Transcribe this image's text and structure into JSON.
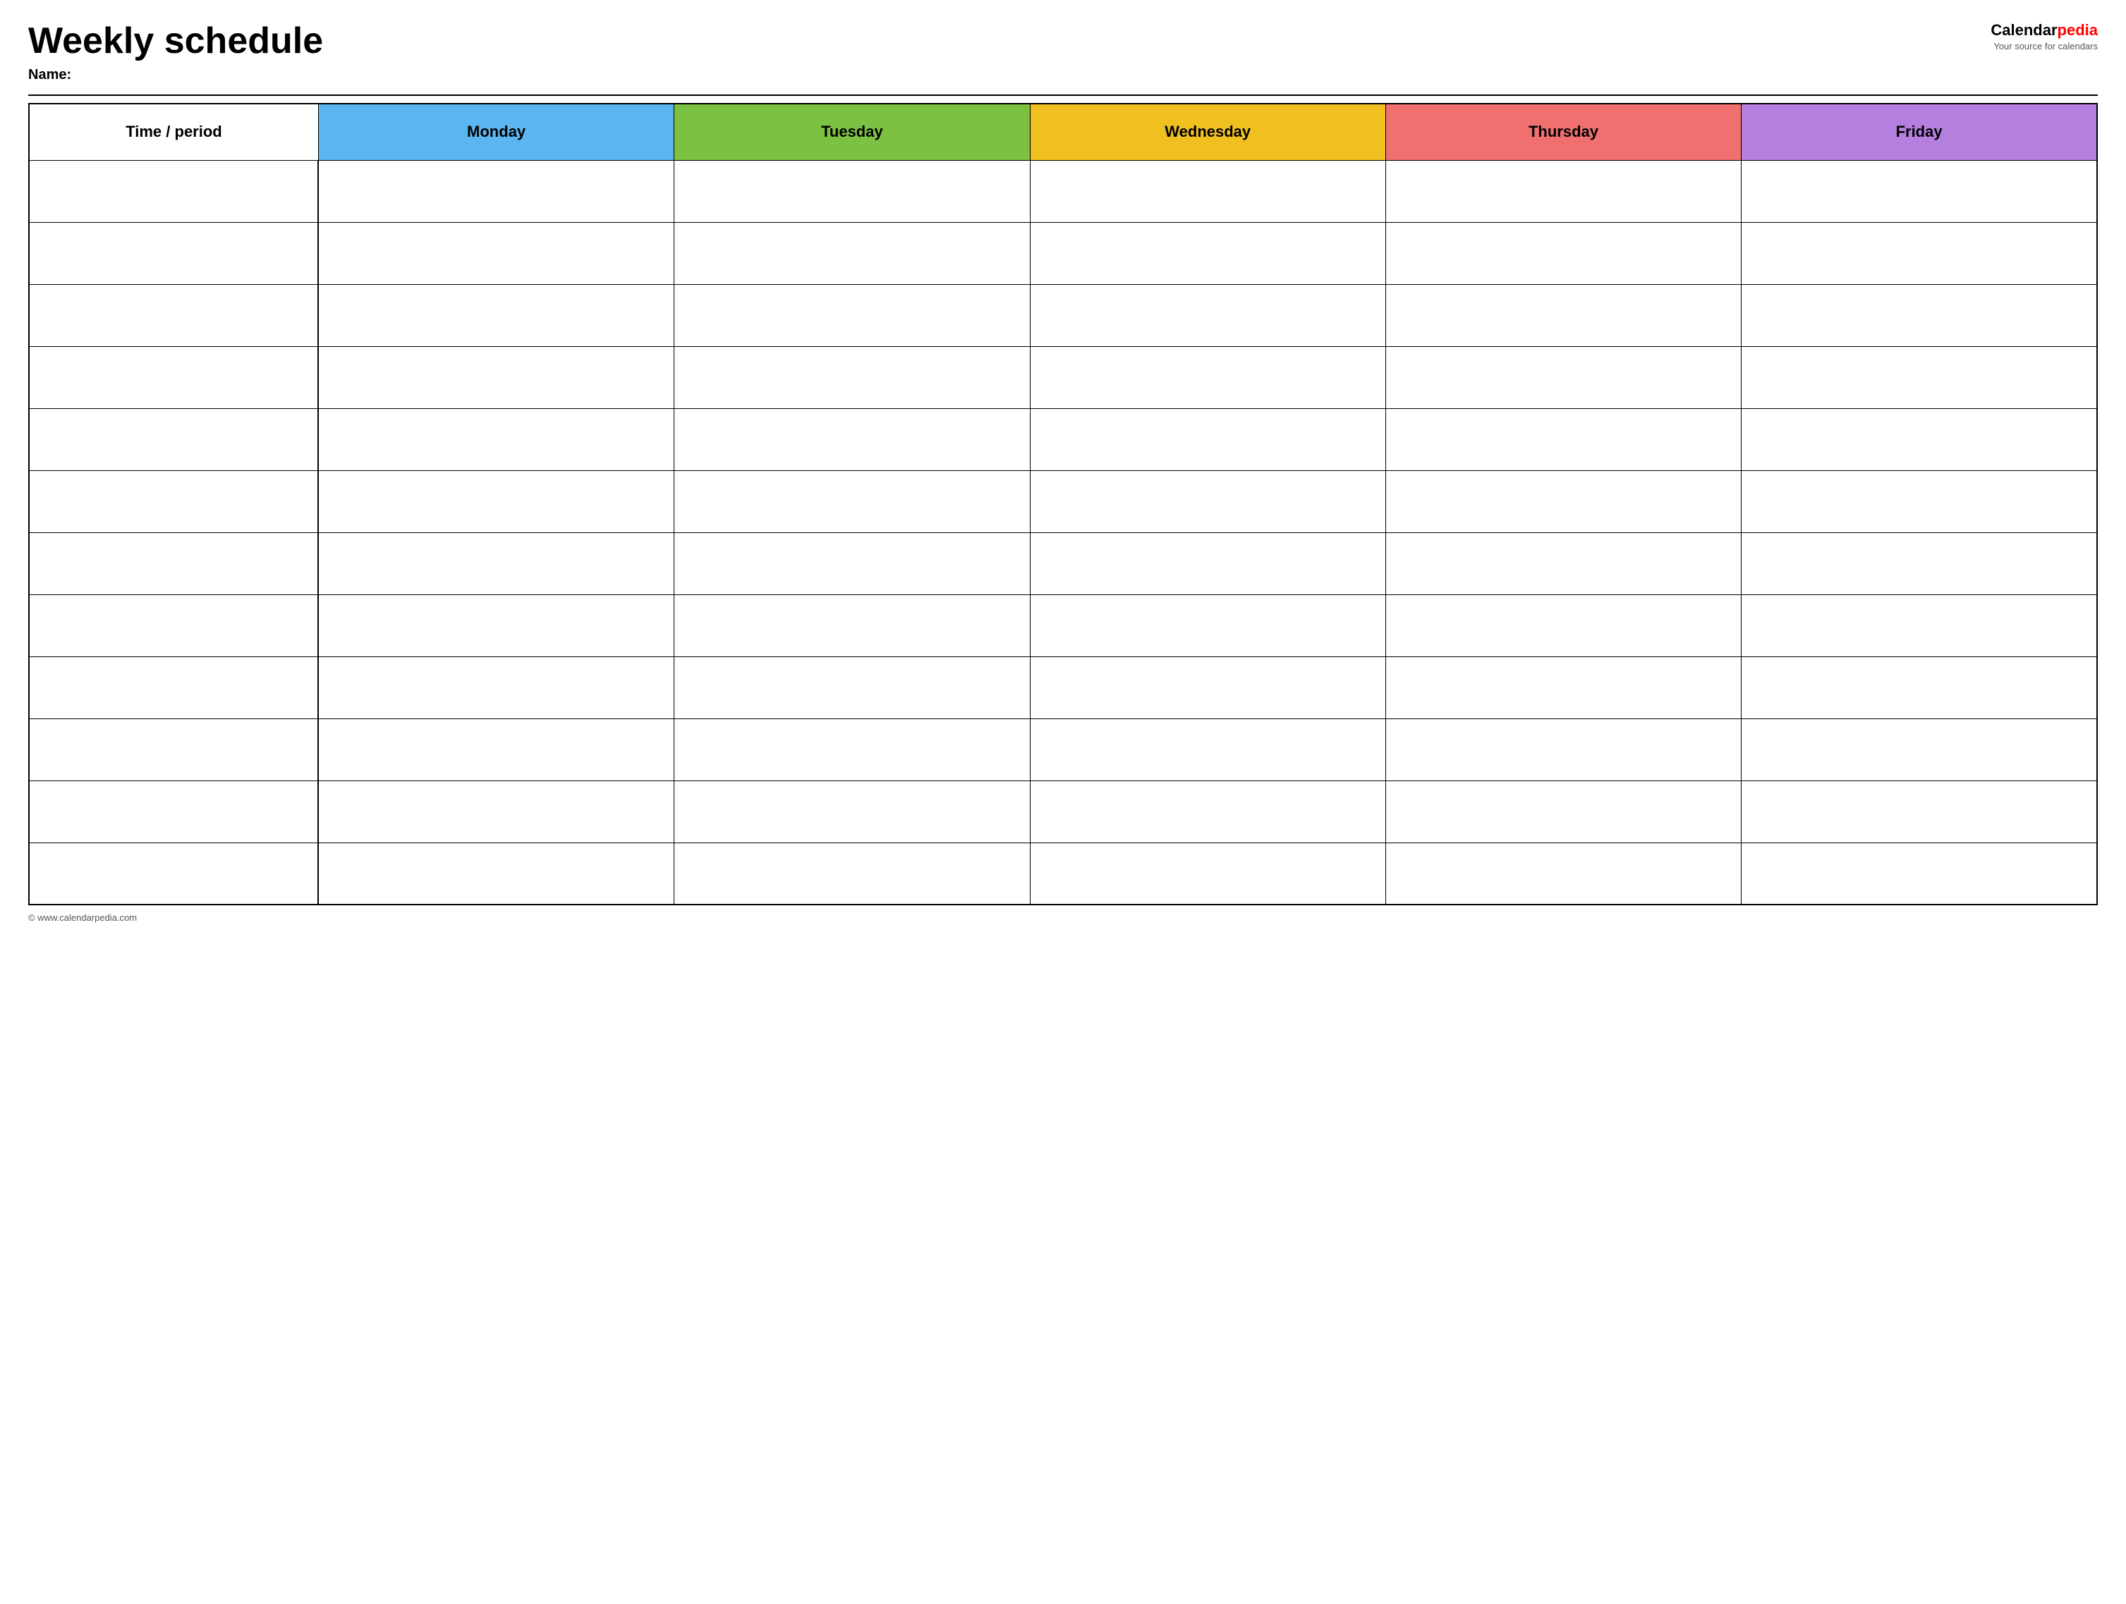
{
  "header": {
    "title": "Weekly schedule",
    "name_label": "Name:",
    "logo": {
      "part1": "Calendar",
      "part2": "pedia",
      "tagline": "Your source for calendars"
    }
  },
  "table": {
    "columns": [
      {
        "id": "time",
        "label": "Time / period",
        "color": "#ffffff"
      },
      {
        "id": "monday",
        "label": "Monday",
        "color": "#5bb5f0"
      },
      {
        "id": "tuesday",
        "label": "Tuesday",
        "color": "#7dc142"
      },
      {
        "id": "wednesday",
        "label": "Wednesday",
        "color": "#f0c020"
      },
      {
        "id": "thursday",
        "label": "Thursday",
        "color": "#f07070"
      },
      {
        "id": "friday",
        "label": "Friday",
        "color": "#b57fe0"
      }
    ],
    "row_count": 12
  },
  "footer": {
    "url": "© www.calendarpedia.com"
  }
}
